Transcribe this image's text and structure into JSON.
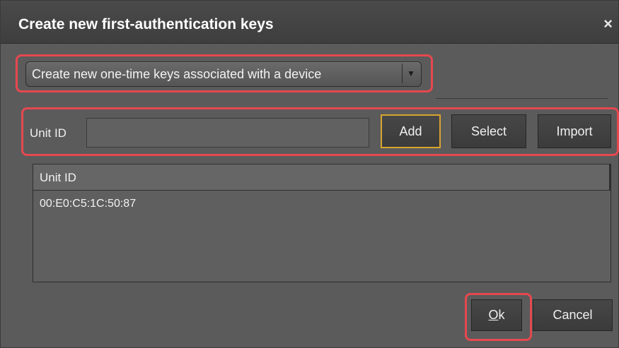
{
  "dialog": {
    "title": "Create new first-authentication keys",
    "close_glyph": "×",
    "close_icon": "close-icon"
  },
  "mode_select": {
    "selected_value": "Create new one-time keys associated with a device",
    "arrow_glyph": "▼",
    "arrow_icon": "dropdown-arrow-icon"
  },
  "unit_input": {
    "label": "Unit ID",
    "value": "",
    "placeholder": ""
  },
  "buttons": {
    "add": "Add",
    "select": "Select",
    "import": "Import",
    "ok_mnemonic": "O",
    "ok_rest": "k",
    "cancel": "Cancel"
  },
  "table": {
    "columns": [
      "Unit ID"
    ],
    "rows": [
      [
        "00:E0:C5:1C:50:87"
      ]
    ]
  },
  "colors": {
    "highlight": "#e5484f",
    "focus_border": "#d8a530",
    "dialog_bg": "#5b5b5b",
    "titlebar_bg": "#3e3e3e"
  }
}
